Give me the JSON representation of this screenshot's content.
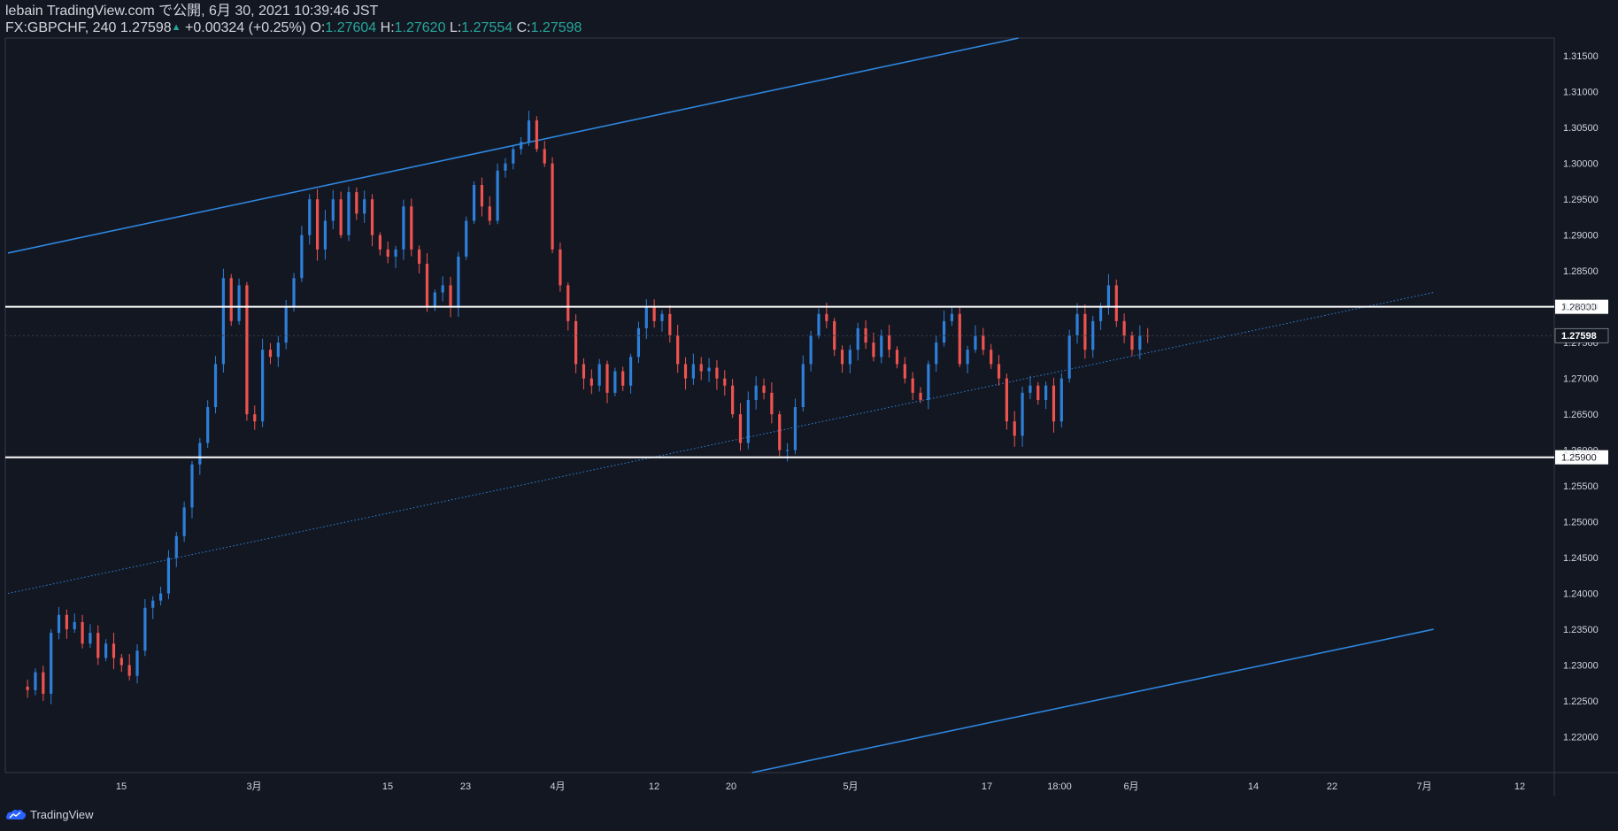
{
  "header": {
    "publisher": "lebain TradingView.com で公開, 6月 30, 2021 10:39:46 JST",
    "symbol_line": "FX:GBPCHF, 240 1.27598",
    "change": "+0.00324 (+0.25%)",
    "o_label": "O:",
    "o_value": "1.27604",
    "h_label": "H:",
    "h_value": "1.27620",
    "l_label": "L:",
    "l_value": "1.27554",
    "c_label": "C:",
    "c_value": "1.27598"
  },
  "footer": {
    "brand": "TradingView",
    "icon": "tradingview-cloud-icon"
  },
  "colors": {
    "background": "#131722",
    "up": "#2e7fd9",
    "down": "#ef5350",
    "trendline": "#2e86de",
    "level": "#ffffff",
    "axis_text": "#d1d4dc",
    "header_value": "#26a69a"
  },
  "chart_data": {
    "type": "candlestick",
    "symbol": "FX:GBPCHF",
    "interval": "240",
    "ylim": [
      1.215,
      1.3175
    ],
    "y_ticks": [
      "1.31500",
      "1.31000",
      "1.30500",
      "1.30000",
      "1.29500",
      "1.29000",
      "1.28500",
      "1.28000",
      "1.27500",
      "1.27000",
      "1.26500",
      "1.26000",
      "1.25500",
      "1.25000",
      "1.24500",
      "1.24000",
      "1.23500",
      "1.23000",
      "1.22500",
      "1.22000"
    ],
    "x_ticks": [
      "15",
      "3月",
      "15",
      "23",
      "4月",
      "12",
      "20",
      "5月",
      "17",
      "18:00",
      "6月",
      "14",
      "22",
      "7月",
      "12"
    ],
    "horizontal_levels": [
      "1.28000",
      "1.25900"
    ],
    "last_price": "1.27598",
    "close_path": [
      [
        0,
        1.227
      ],
      [
        2,
        1.2265
      ],
      [
        3,
        1.229
      ],
      [
        4,
        1.226
      ],
      [
        5,
        1.2345
      ],
      [
        6,
        1.237
      ],
      [
        7,
        1.235
      ],
      [
        8,
        1.236
      ],
      [
        9,
        1.233
      ],
      [
        10,
        1.2345
      ],
      [
        11,
        1.231
      ],
      [
        12,
        1.233
      ],
      [
        13,
        1.231
      ],
      [
        14,
        1.23
      ],
      [
        15,
        1.2285
      ],
      [
        16,
        1.232
      ],
      [
        17,
        1.238
      ],
      [
        18,
        1.239
      ],
      [
        19,
        1.24
      ],
      [
        20,
        1.245
      ],
      [
        21,
        1.248
      ],
      [
        22,
        1.252
      ],
      [
        23,
        1.258
      ],
      [
        24,
        1.261
      ],
      [
        25,
        1.266
      ],
      [
        26,
        1.272
      ],
      [
        27,
        1.284
      ],
      [
        28,
        1.278
      ],
      [
        29,
        1.283
      ],
      [
        30,
        1.265
      ],
      [
        31,
        1.264
      ],
      [
        32,
        1.274
      ],
      [
        33,
        1.273
      ],
      [
        34,
        1.275
      ],
      [
        35,
        1.28
      ],
      [
        36,
        1.284
      ],
      [
        37,
        1.29
      ],
      [
        38,
        1.295
      ],
      [
        39,
        1.288
      ],
      [
        40,
        1.292
      ],
      [
        41,
        1.295
      ],
      [
        42,
        1.29
      ],
      [
        43,
        1.296
      ],
      [
        44,
        1.293
      ],
      [
        45,
        1.295
      ],
      [
        46,
        1.29
      ],
      [
        47,
        1.288
      ],
      [
        48,
        1.287
      ],
      [
        49,
        1.288
      ],
      [
        50,
        1.294
      ],
      [
        51,
        1.288
      ],
      [
        52,
        1.286
      ],
      [
        53,
        1.28
      ],
      [
        54,
        1.282
      ],
      [
        55,
        1.283
      ],
      [
        56,
        1.28
      ],
      [
        57,
        1.287
      ],
      [
        58,
        1.292
      ],
      [
        59,
        1.297
      ],
      [
        60,
        1.294
      ],
      [
        61,
        1.292
      ],
      [
        62,
        1.299
      ],
      [
        63,
        1.3
      ],
      [
        64,
        1.302
      ],
      [
        65,
        1.303
      ],
      [
        66,
        1.306
      ],
      [
        67,
        1.302
      ],
      [
        68,
        1.3
      ],
      [
        69,
        1.288
      ],
      [
        70,
        1.283
      ],
      [
        71,
        1.278
      ],
      [
        72,
        1.272
      ],
      [
        73,
        1.27
      ],
      [
        74,
        1.269
      ],
      [
        75,
        1.272
      ],
      [
        76,
        1.268
      ],
      [
        77,
        1.271
      ],
      [
        78,
        1.269
      ],
      [
        79,
        1.273
      ],
      [
        80,
        1.277
      ],
      [
        81,
        1.28
      ],
      [
        82,
        1.278
      ],
      [
        83,
        1.279
      ],
      [
        84,
        1.276
      ],
      [
        85,
        1.272
      ],
      [
        86,
        1.27
      ],
      [
        87,
        1.272
      ],
      [
        88,
        1.271
      ],
      [
        89,
        1.2715
      ],
      [
        90,
        1.27
      ],
      [
        91,
        1.269
      ],
      [
        92,
        1.265
      ],
      [
        93,
        1.261
      ],
      [
        94,
        1.267
      ],
      [
        95,
        1.269
      ],
      [
        96,
        1.268
      ],
      [
        97,
        1.265
      ],
      [
        98,
        1.26
      ],
      [
        99,
        1.26
      ],
      [
        100,
        1.266
      ],
      [
        101,
        1.272
      ],
      [
        102,
        1.276
      ],
      [
        103,
        1.279
      ],
      [
        104,
        1.278
      ],
      [
        105,
        1.274
      ],
      [
        106,
        1.272
      ],
      [
        107,
        1.274
      ],
      [
        108,
        1.277
      ],
      [
        109,
        1.275
      ],
      [
        110,
        1.273
      ],
      [
        111,
        1.276
      ],
      [
        112,
        1.274
      ],
      [
        113,
        1.272
      ],
      [
        114,
        1.27
      ],
      [
        115,
        1.268
      ],
      [
        116,
        1.267
      ],
      [
        117,
        1.272
      ],
      [
        118,
        1.275
      ],
      [
        119,
        1.278
      ],
      [
        120,
        1.279
      ],
      [
        121,
        1.272
      ],
      [
        122,
        1.274
      ],
      [
        123,
        1.276
      ],
      [
        124,
        1.274
      ],
      [
        125,
        1.272
      ],
      [
        126,
        1.27
      ],
      [
        127,
        1.264
      ],
      [
        128,
        1.262
      ],
      [
        129,
        1.268
      ],
      [
        130,
        1.269
      ],
      [
        131,
        1.267
      ],
      [
        132,
        1.269
      ],
      [
        133,
        1.264
      ],
      [
        134,
        1.27
      ],
      [
        135,
        1.276
      ],
      [
        136,
        1.279
      ],
      [
        137,
        1.274
      ],
      [
        138,
        1.278
      ],
      [
        139,
        1.28
      ],
      [
        140,
        1.283
      ],
      [
        141,
        1.278
      ],
      [
        142,
        1.276
      ],
      [
        143,
        1.274
      ],
      [
        144,
        1.276
      ],
      [
        145,
        1.27598
      ]
    ],
    "channel_upper": [
      [
        0,
        1.2875
      ],
      [
        129,
        1.3175
      ]
    ],
    "channel_mid": [
      [
        0,
        1.24
      ],
      [
        182,
        1.282
      ]
    ],
    "channel_lower": [
      [
        95,
        1.215
      ],
      [
        182,
        1.235
      ]
    ]
  }
}
